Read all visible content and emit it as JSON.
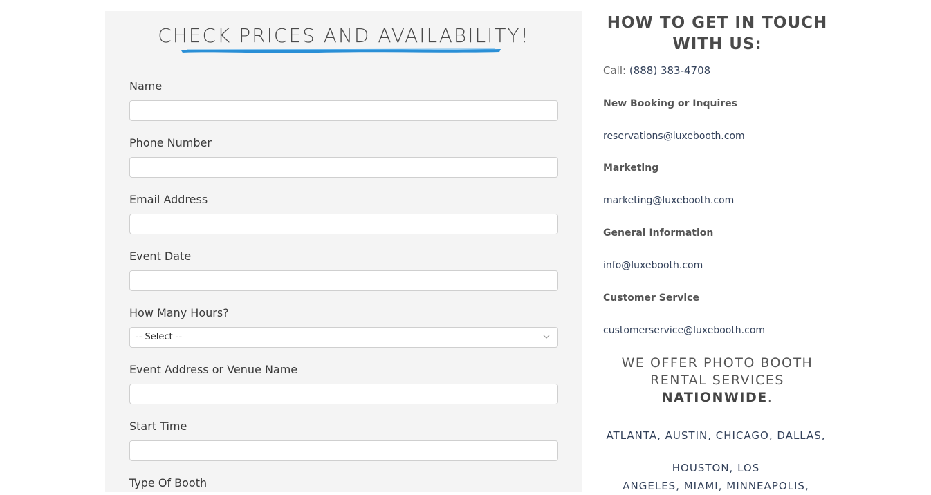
{
  "form": {
    "title": "CHECK PRICES AND AVAILABILITY!",
    "fields": [
      {
        "label": "Name",
        "type": "text",
        "value": ""
      },
      {
        "label": "Phone Number",
        "type": "text",
        "value": ""
      },
      {
        "label": "Email Address",
        "type": "text",
        "value": ""
      },
      {
        "label": "Event Date",
        "type": "text",
        "value": ""
      },
      {
        "label": "How Many Hours?",
        "type": "select",
        "value": "-- Select --"
      },
      {
        "label": "Event Address or Venue Name",
        "type": "text",
        "value": ""
      },
      {
        "label": "Start Time",
        "type": "text",
        "value": ""
      },
      {
        "label": "Type Of Booth",
        "type": "text",
        "value": ""
      }
    ]
  },
  "contact": {
    "title_line1": "HOW TO GET IN TOUCH",
    "title_line2": "WITH US:",
    "call_label": "Call:",
    "phone": "(888) 383-4708",
    "sections": [
      {
        "heading": "New Booking or Inquires",
        "email": "reservations@luxebooth.com"
      },
      {
        "heading": "Marketing",
        "email": "marketing@luxebooth.com"
      },
      {
        "heading": "General Information",
        "email": "info@luxebooth.com"
      },
      {
        "heading": "Customer Service",
        "email": "customerservice@luxebooth.com"
      }
    ],
    "nationwide_line1": "WE OFFER PHOTO BOOTH",
    "nationwide_line2": "RENTAL SERVICES",
    "nationwide_bold": "NATIONWIDE",
    "nationwide_period": ".",
    "cities_line1": "ATLANTA, AUSTIN, CHICAGO, DALLAS,",
    "cities_line2": "HOUSTON, LOS",
    "cities_line3": "ANGELES, MIAMI, MINNEAPOLIS,"
  },
  "colors": {
    "panel_bg": "#f4f4f4",
    "brush_accent": "#2a8fd6",
    "link_text": "#33415a"
  }
}
